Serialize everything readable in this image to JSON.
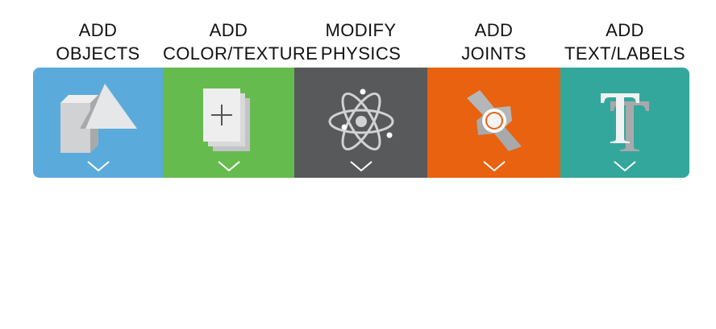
{
  "toolbar": {
    "items": [
      {
        "line1": "ADD",
        "line2": "OBJECTS",
        "color": "#5aabdb",
        "icon": "shapes-icon"
      },
      {
        "line1": "ADD",
        "line2": "COLOR/TEXTURE",
        "color": "#66bb4f",
        "icon": "layers-add-icon"
      },
      {
        "line1": "MODIFY",
        "line2": "PHYSICS",
        "color": "#58595b",
        "icon": "atom-icon"
      },
      {
        "line1": "ADD",
        "line2": "JOINTS",
        "color": "#e8620f",
        "icon": "joint-icon"
      },
      {
        "line1": "ADD",
        "line2": "TEXT/LABELS",
        "color": "#34a79c",
        "icon": "text-icon"
      }
    ]
  }
}
